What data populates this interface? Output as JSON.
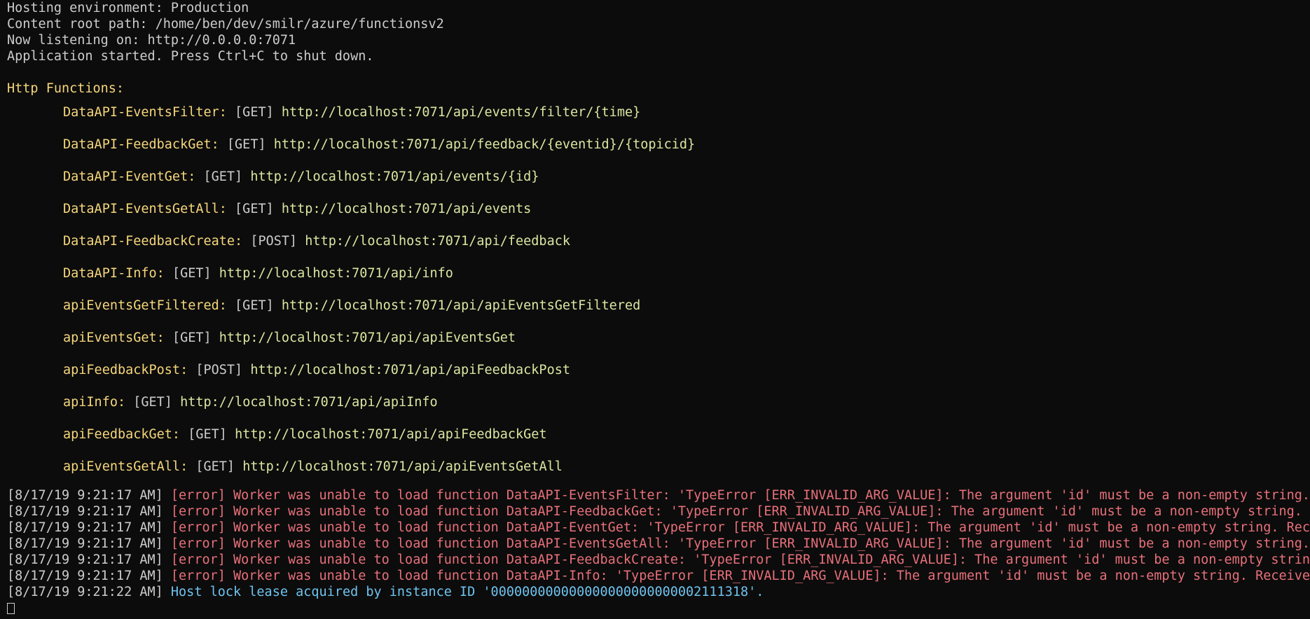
{
  "header": [
    "Hosting environment: Production",
    "Content root path: /home/ben/dev/smilr/azure/functionsv2",
    "Now listening on: http://0.0.0.0:7071",
    "Application started. Press Ctrl+C to shut down."
  ],
  "http_functions_title": "Http Functions:",
  "functions": [
    {
      "name": "DataAPI-EventsFilter:",
      "method": "[GET]",
      "url": "http://localhost:7071/api/events/filter/{time}"
    },
    {
      "name": "DataAPI-FeedbackGet:",
      "method": "[GET]",
      "url": "http://localhost:7071/api/feedback/{eventid}/{topicid}"
    },
    {
      "name": "DataAPI-EventGet:",
      "method": "[GET]",
      "url": "http://localhost:7071/api/events/{id}"
    },
    {
      "name": "DataAPI-EventsGetAll:",
      "method": "[GET]",
      "url": "http://localhost:7071/api/events"
    },
    {
      "name": "DataAPI-FeedbackCreate:",
      "method": "[POST]",
      "url": "http://localhost:7071/api/feedback"
    },
    {
      "name": "DataAPI-Info:",
      "method": "[GET]",
      "url": "http://localhost:7071/api/info"
    },
    {
      "name": "apiEventsGetFiltered:",
      "method": "[GET]",
      "url": "http://localhost:7071/api/apiEventsGetFiltered"
    },
    {
      "name": "apiEventsGet:",
      "method": "[GET]",
      "url": "http://localhost:7071/api/apiEventsGet"
    },
    {
      "name": "apiFeedbackPost:",
      "method": "[POST]",
      "url": "http://localhost:7071/api/apiFeedbackPost"
    },
    {
      "name": "apiInfo:",
      "method": "[GET]",
      "url": "http://localhost:7071/api/apiInfo"
    },
    {
      "name": "apiFeedbackGet:",
      "method": "[GET]",
      "url": "http://localhost:7071/api/apiFeedbackGet"
    },
    {
      "name": "apiEventsGetAll:",
      "method": "[GET]",
      "url": "http://localhost:7071/api/apiEventsGetAll"
    }
  ],
  "logs": [
    {
      "timestamp": "[8/17/19 9:21:17 AM]",
      "level": "[error]",
      "message": "Worker was unable to load function DataAPI-EventsFilter: 'TypeError [ERR_INVALID_ARG_VALUE]: The argument 'id' must be a non-empty string. Received '''"
    },
    {
      "timestamp": "[8/17/19 9:21:17 AM]",
      "level": "[error]",
      "message": "Worker was unable to load function DataAPI-FeedbackGet: 'TypeError [ERR_INVALID_ARG_VALUE]: The argument 'id' must be a non-empty string. Received '''"
    },
    {
      "timestamp": "[8/17/19 9:21:17 AM]",
      "level": "[error]",
      "message": "Worker was unable to load function DataAPI-EventGet: 'TypeError [ERR_INVALID_ARG_VALUE]: The argument 'id' must be a non-empty string. Received '''"
    },
    {
      "timestamp": "[8/17/19 9:21:17 AM]",
      "level": "[error]",
      "message": "Worker was unable to load function DataAPI-EventsGetAll: 'TypeError [ERR_INVALID_ARG_VALUE]: The argument 'id' must be a non-empty string. Received '''"
    },
    {
      "timestamp": "[8/17/19 9:21:17 AM]",
      "level": "[error]",
      "message": "Worker was unable to load function DataAPI-FeedbackCreate: 'TypeError [ERR_INVALID_ARG_VALUE]: The argument 'id' must be a non-empty string. Received '''"
    },
    {
      "timestamp": "[8/17/19 9:21:17 AM]",
      "level": "[error]",
      "message": "Worker was unable to load function DataAPI-Info: 'TypeError [ERR_INVALID_ARG_VALUE]: The argument 'id' must be a non-empty string. Received '''"
    }
  ],
  "info_log": {
    "timestamp": "[8/17/19 9:21:22 AM]",
    "message": "Host lock lease acquired by instance ID '000000000000000000000000002111318'."
  },
  "colors": {
    "background": "#0c0c0c",
    "text": "#cccccc",
    "function_name": "#f5d67b",
    "url": "#dbe6a0",
    "error": "#e8707a",
    "info": "#6fc3ef"
  }
}
